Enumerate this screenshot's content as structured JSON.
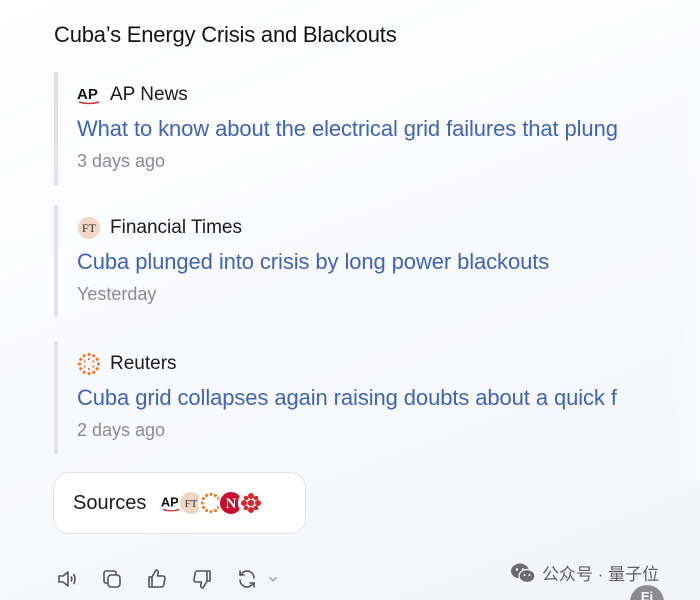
{
  "heading": "Cuba’s Energy Crisis and Blackouts",
  "articles": [
    {
      "source": "AP News",
      "logo": "AP",
      "headline": "What to know about the electrical grid failures that plung",
      "time": "3 days ago"
    },
    {
      "source": "Financial Times",
      "logo": "FT",
      "headline": "Cuba plunged into crisis by long power blackouts",
      "time": "Yesterday"
    },
    {
      "source": "Reuters",
      "logo": "reuters-logo",
      "headline": "Cuba grid collapses again raising doubts about a quick f",
      "time": "2 days ago"
    }
  ],
  "sources_button": {
    "label": "Sources",
    "favicons": [
      {
        "label": "AP",
        "icon": "ap-logo",
        "color": "#1b1b1b"
      },
      {
        "label": "FT",
        "icon": "ft-logo",
        "color": "#f0d5c0"
      },
      {
        "label": "",
        "icon": "reuters-logo",
        "color": "#f47a2c"
      },
      {
        "label": "N",
        "icon": "n-logo",
        "color": "#c8102e"
      },
      {
        "label": "",
        "icon": "cbc-logo",
        "color": "#d8262e"
      }
    ]
  },
  "actions": [
    "speaker-icon",
    "copy-icon",
    "thumbs-up-icon",
    "thumbs-down-icon",
    "regenerate-icon",
    "chevron-down-icon"
  ],
  "watermark": {
    "text": "公众号 · 量子位",
    "icon": "wechat-icon"
  },
  "corner_badge": "Ei",
  "colors": {
    "headline": "#3f63b5",
    "muted": "#8b8b8f",
    "border": "#e3e3e6"
  }
}
